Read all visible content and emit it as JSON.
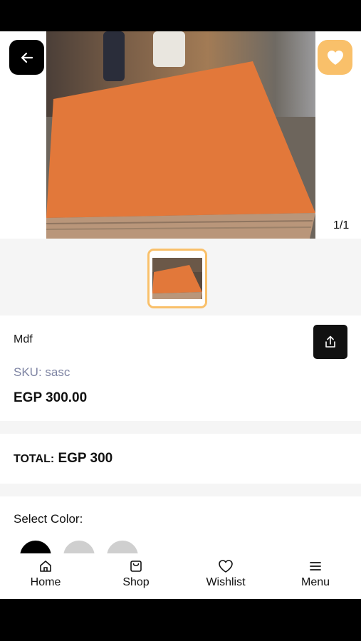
{
  "product": {
    "name": "Mdf",
    "sku_label": "SKU:",
    "sku_value": "sasc",
    "price": "EGP 300.00",
    "image_counter": "1/1"
  },
  "total": {
    "label": "TOTAL:",
    "value": "EGP 300"
  },
  "color": {
    "title": "Select Color:",
    "swatches": [
      "#000000",
      "#cfcfcf",
      "#cfcfcf"
    ]
  },
  "nav": {
    "items": [
      {
        "label": "Home",
        "icon": "home-icon"
      },
      {
        "label": "Shop",
        "icon": "shopping-bag-icon"
      },
      {
        "label": "Wishlist",
        "icon": "heart-icon"
      },
      {
        "label": "Menu",
        "icon": "menu-icon"
      }
    ]
  },
  "colors": {
    "accent": "#f9c06a",
    "dark": "#111111",
    "sku": "#7e84a3"
  }
}
